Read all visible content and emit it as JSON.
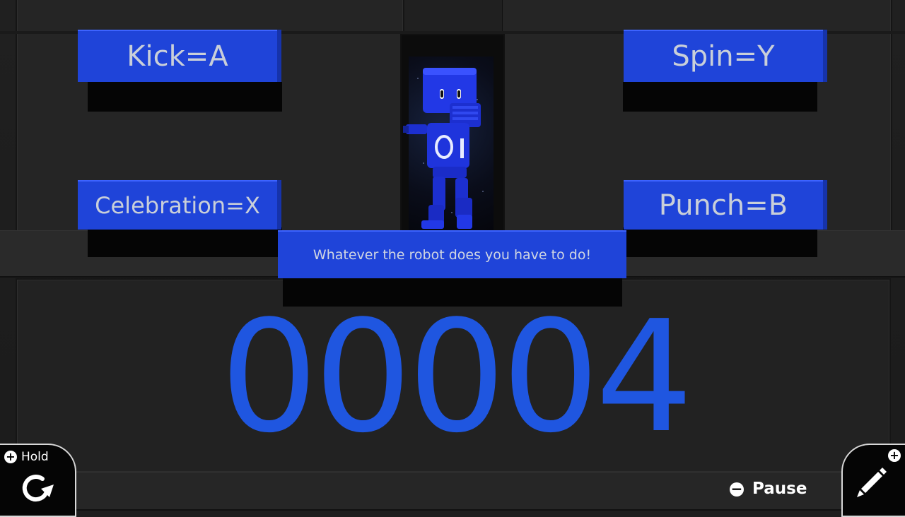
{
  "controls": [
    {
      "label": "Kick=A"
    },
    {
      "label": "Spin=Y"
    },
    {
      "label": "Celebration=X"
    },
    {
      "label": "Punch=B"
    }
  ],
  "instruction": "Whatever the robot does you have to do!",
  "score": "00004",
  "hud": {
    "hold_label": "Hold",
    "hold_icon": "plus-icon",
    "pause_label": "Pause",
    "pause_icon": "minus-icon",
    "edit_icon": "pencil-icon"
  },
  "colors": {
    "accent_blue": "#1f44d9",
    "score_blue": "#1f56e0",
    "background": "#1e1e1e"
  }
}
